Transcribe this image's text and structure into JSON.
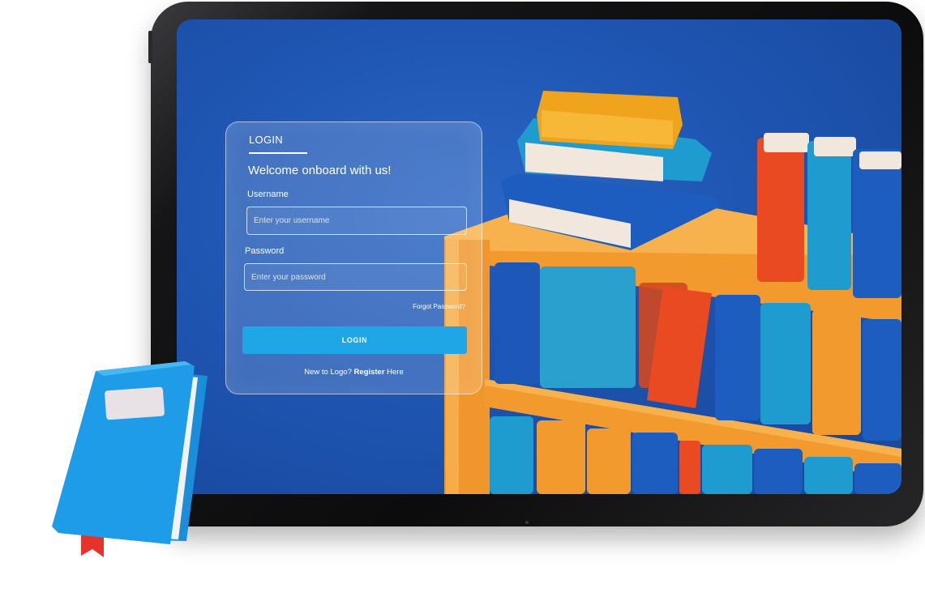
{
  "login": {
    "title": "LOGIN",
    "welcome": "Welcome onboard with us!",
    "username_label": "Username",
    "username_placeholder": "Enter your username",
    "username_value": "",
    "password_label": "Password",
    "password_placeholder": "Enter your password",
    "password_value": "",
    "forgot_password": "Forgot Password?",
    "button_label": "LOGIN",
    "register_prefix": "New to Logo?",
    "register_link": "Register",
    "register_suffix": "Here"
  },
  "colors": {
    "screen_background": "#1f56b3",
    "button": "#1fa6e6",
    "card_border": "#ffffff",
    "notebook": "#1e9ce8",
    "bookmark": "#e5322b",
    "shelf": "#f5a23a"
  },
  "icons": {
    "notebook": "notebook-icon",
    "bookshelf": "bookshelf-illustration"
  }
}
